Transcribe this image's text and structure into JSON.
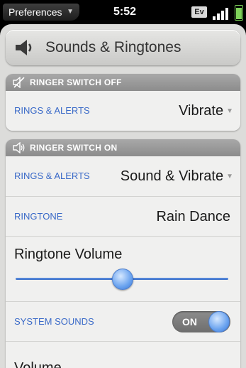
{
  "statusbar": {
    "app_menu": "Preferences",
    "time": "5:52",
    "network_badge": "Ev"
  },
  "header": {
    "title": "Sounds & Ringtones",
    "icon": "speaker-icon"
  },
  "ringer_off": {
    "heading": "RINGER SWITCH OFF",
    "icon": "muted-speaker-icon",
    "rings_label": "RINGS & ALERTS",
    "rings_value": "Vibrate"
  },
  "ringer_on": {
    "heading": "RINGER SWITCH ON",
    "icon": "speaker-on-icon",
    "rings_label": "RINGS & ALERTS",
    "rings_value": "Sound & Vibrate",
    "ringtone_label": "RINGTONE",
    "ringtone_value": "Rain Dance",
    "ringtone_volume_label": "Ringtone Volume",
    "ringtone_volume_level": 0.5,
    "system_sounds_label": "SYSTEM SOUNDS",
    "system_sounds_toggle": "ON",
    "volume_label": "Volume"
  },
  "colors": {
    "accent_label": "#3a6ac8",
    "slider": "#4a7fd6",
    "battery": "#7fd35a"
  }
}
